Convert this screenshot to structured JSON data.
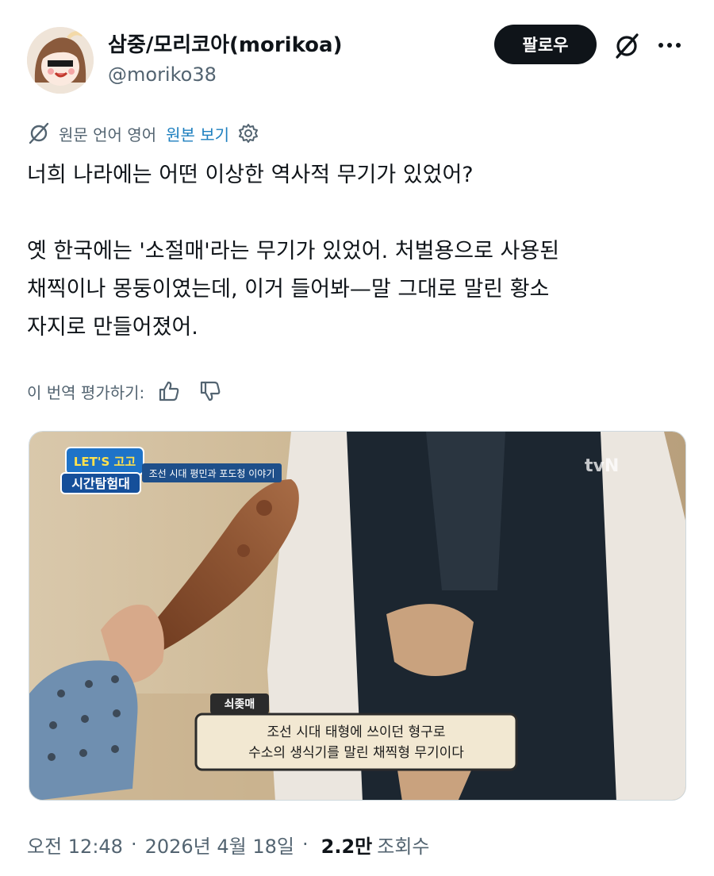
{
  "author": {
    "display_name": "삼중/모리코아(morikoa)",
    "handle": "@moriko38"
  },
  "header": {
    "follow_label": "팔로우",
    "grok_icon": "grok-slash-icon",
    "more_icon": "more-dots-icon"
  },
  "translation": {
    "source_language_text": "원문 언어 영어",
    "show_original_label": "원본 보기",
    "icon": "translate-icon",
    "settings_icon": "gear-icon"
  },
  "tweet": {
    "lines": [
      "너희 나라에는 어떤 이상한 역사적 무기가 있었어?",
      "옛 한국에는 '소절매'라는 무기가 있었어. 처벌용으로 사용된",
      "채찍이나 몽둥이였는데, 이거 들어봐—말 그대로 말린 황소",
      "자지로 만들어졌어."
    ]
  },
  "rating": {
    "label": "이 번역 평가하기:",
    "thumbs_up_icon": "thumbs-up-icon",
    "thumbs_down_icon": "thumbs-down-icon"
  },
  "media": {
    "show_logo_line1": "LET'S 고고",
    "show_logo_line2": "시간탐험대",
    "episode_banner": "조선 시대 평민과 포도청 이야기",
    "channel_watermark": "tvN",
    "caption_title": "쇠좆매",
    "caption_line1": "조선 시대 태형에 쓰이던 형구로",
    "caption_line2": "수소의 생식기를 말린 채찍형 무기이다"
  },
  "meta": {
    "time": "오전 12:48",
    "separator": "·",
    "date": "2026년 4월 18일",
    "separator2": "·",
    "views_count": "2.2만",
    "views_label": "조회수"
  }
}
